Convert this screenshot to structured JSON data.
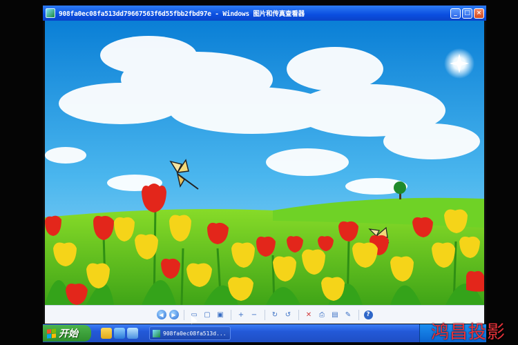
{
  "window": {
    "title": "908fa0ec08fa513dd79667563f6d55fbb2fbd97e - Windows 图片和传真查看器",
    "buttons": {
      "minimize": "_",
      "maximize": "□",
      "close": "×"
    }
  },
  "toolbar": {
    "buttons": [
      {
        "name": "previous-image-button",
        "icon": "◀"
      },
      {
        "name": "next-image-button",
        "icon": "▶"
      },
      {
        "name": "best-fit-button",
        "icon": "▭"
      },
      {
        "name": "actual-size-button",
        "icon": "▢"
      },
      {
        "name": "slideshow-button",
        "icon": "▣"
      },
      {
        "name": "zoom-in-button",
        "icon": "+"
      },
      {
        "name": "zoom-out-button",
        "icon": "−"
      },
      {
        "name": "rotate-clockwise-button",
        "icon": "↻"
      },
      {
        "name": "rotate-counterclockwise-button",
        "icon": "↺"
      },
      {
        "name": "delete-button",
        "icon": "✕"
      },
      {
        "name": "print-button",
        "icon": "⎙"
      },
      {
        "name": "save-button",
        "icon": "▤"
      },
      {
        "name": "edit-button",
        "icon": "✎"
      },
      {
        "name": "help-button",
        "icon": "?"
      }
    ]
  },
  "taskbar": {
    "start_label": "开始",
    "task_item": "908fa0ec08fa513d..."
  },
  "watermark": "鸿昌投影",
  "colors": {
    "sky_top": "#0a7fd6",
    "grass": "#5cc61e",
    "tulip_red": "#e3261b",
    "tulip_yellow": "#f5d419",
    "xp_blue": "#245edb"
  }
}
